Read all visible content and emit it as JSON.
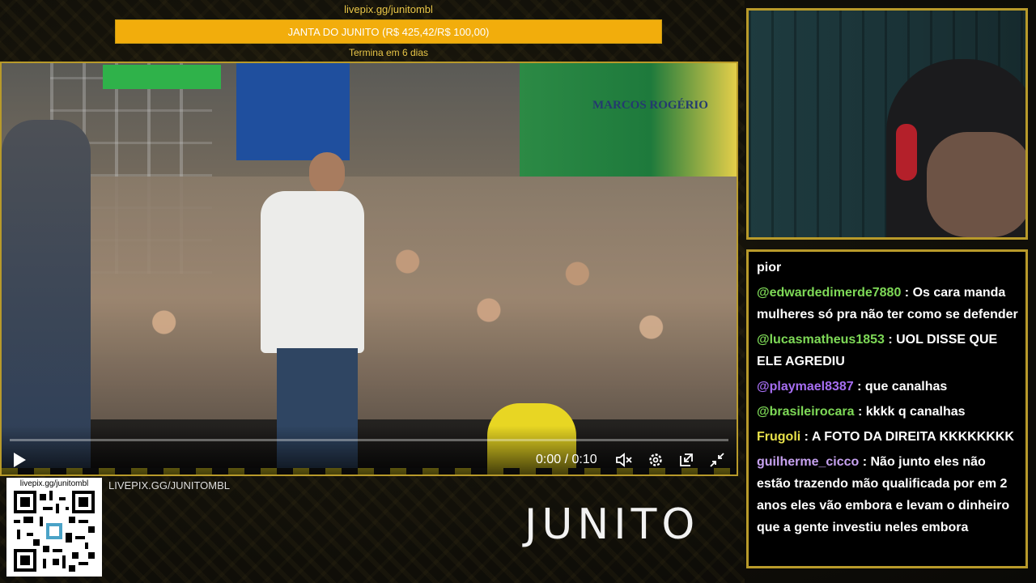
{
  "goal": {
    "url": "livepix.gg/junitombl",
    "text": "JANTA DO JUNITO (R$ 425,42/R$ 100,00)",
    "progress_percent": 100,
    "subtext": "Termina em 6 dias"
  },
  "video": {
    "banner_text": "MARCOS ROGÉRIO",
    "time": "0:00 / 0:10",
    "icons": {
      "play": "play-icon",
      "mute": "volume-muted-icon",
      "settings": "gear-icon",
      "pip": "picture-in-picture-icon",
      "fullscreen": "exit-fullscreen-icon"
    }
  },
  "chat": {
    "messages": [
      {
        "user": "",
        "user_color": "#ffffff",
        "text": "pior"
      },
      {
        "user": "@edwardedimerde7880",
        "user_color": "#7ed957",
        "text": " : Os cara manda mulheres só pra não ter como se defender"
      },
      {
        "user": "@lucasmatheus1853",
        "user_color": "#7ed957",
        "text": " : UOL DISSE QUE ELE AGREDIU"
      },
      {
        "user": "@playmael8387",
        "user_color": "#a66ef2",
        "text": " : que canalhas"
      },
      {
        "user": "@brasileirocara",
        "user_color": "#7ed957",
        "text": " : kkkk q canalhas"
      },
      {
        "user": "Frugoli",
        "user_color": "#e8e14a",
        "text": " : A FOTO DA DIREITA KKKKKKKK"
      },
      {
        "user": "guilherme_cicco",
        "user_color": "#c7a2f0",
        "text": " : Não junto eles não estão trazendo mão qualificada por em 2 anos eles vão embora e levam o dinheiro que a gente investiu neles embora"
      }
    ]
  },
  "qr_label": "livepix.gg/junitombl",
  "site_url": "LIVEPIX.GG/JUNITOMBL",
  "logo_text": "JUNITO",
  "colors": {
    "accent_gold": "#b89a2a",
    "goal_fill": "#f2ad0c"
  }
}
